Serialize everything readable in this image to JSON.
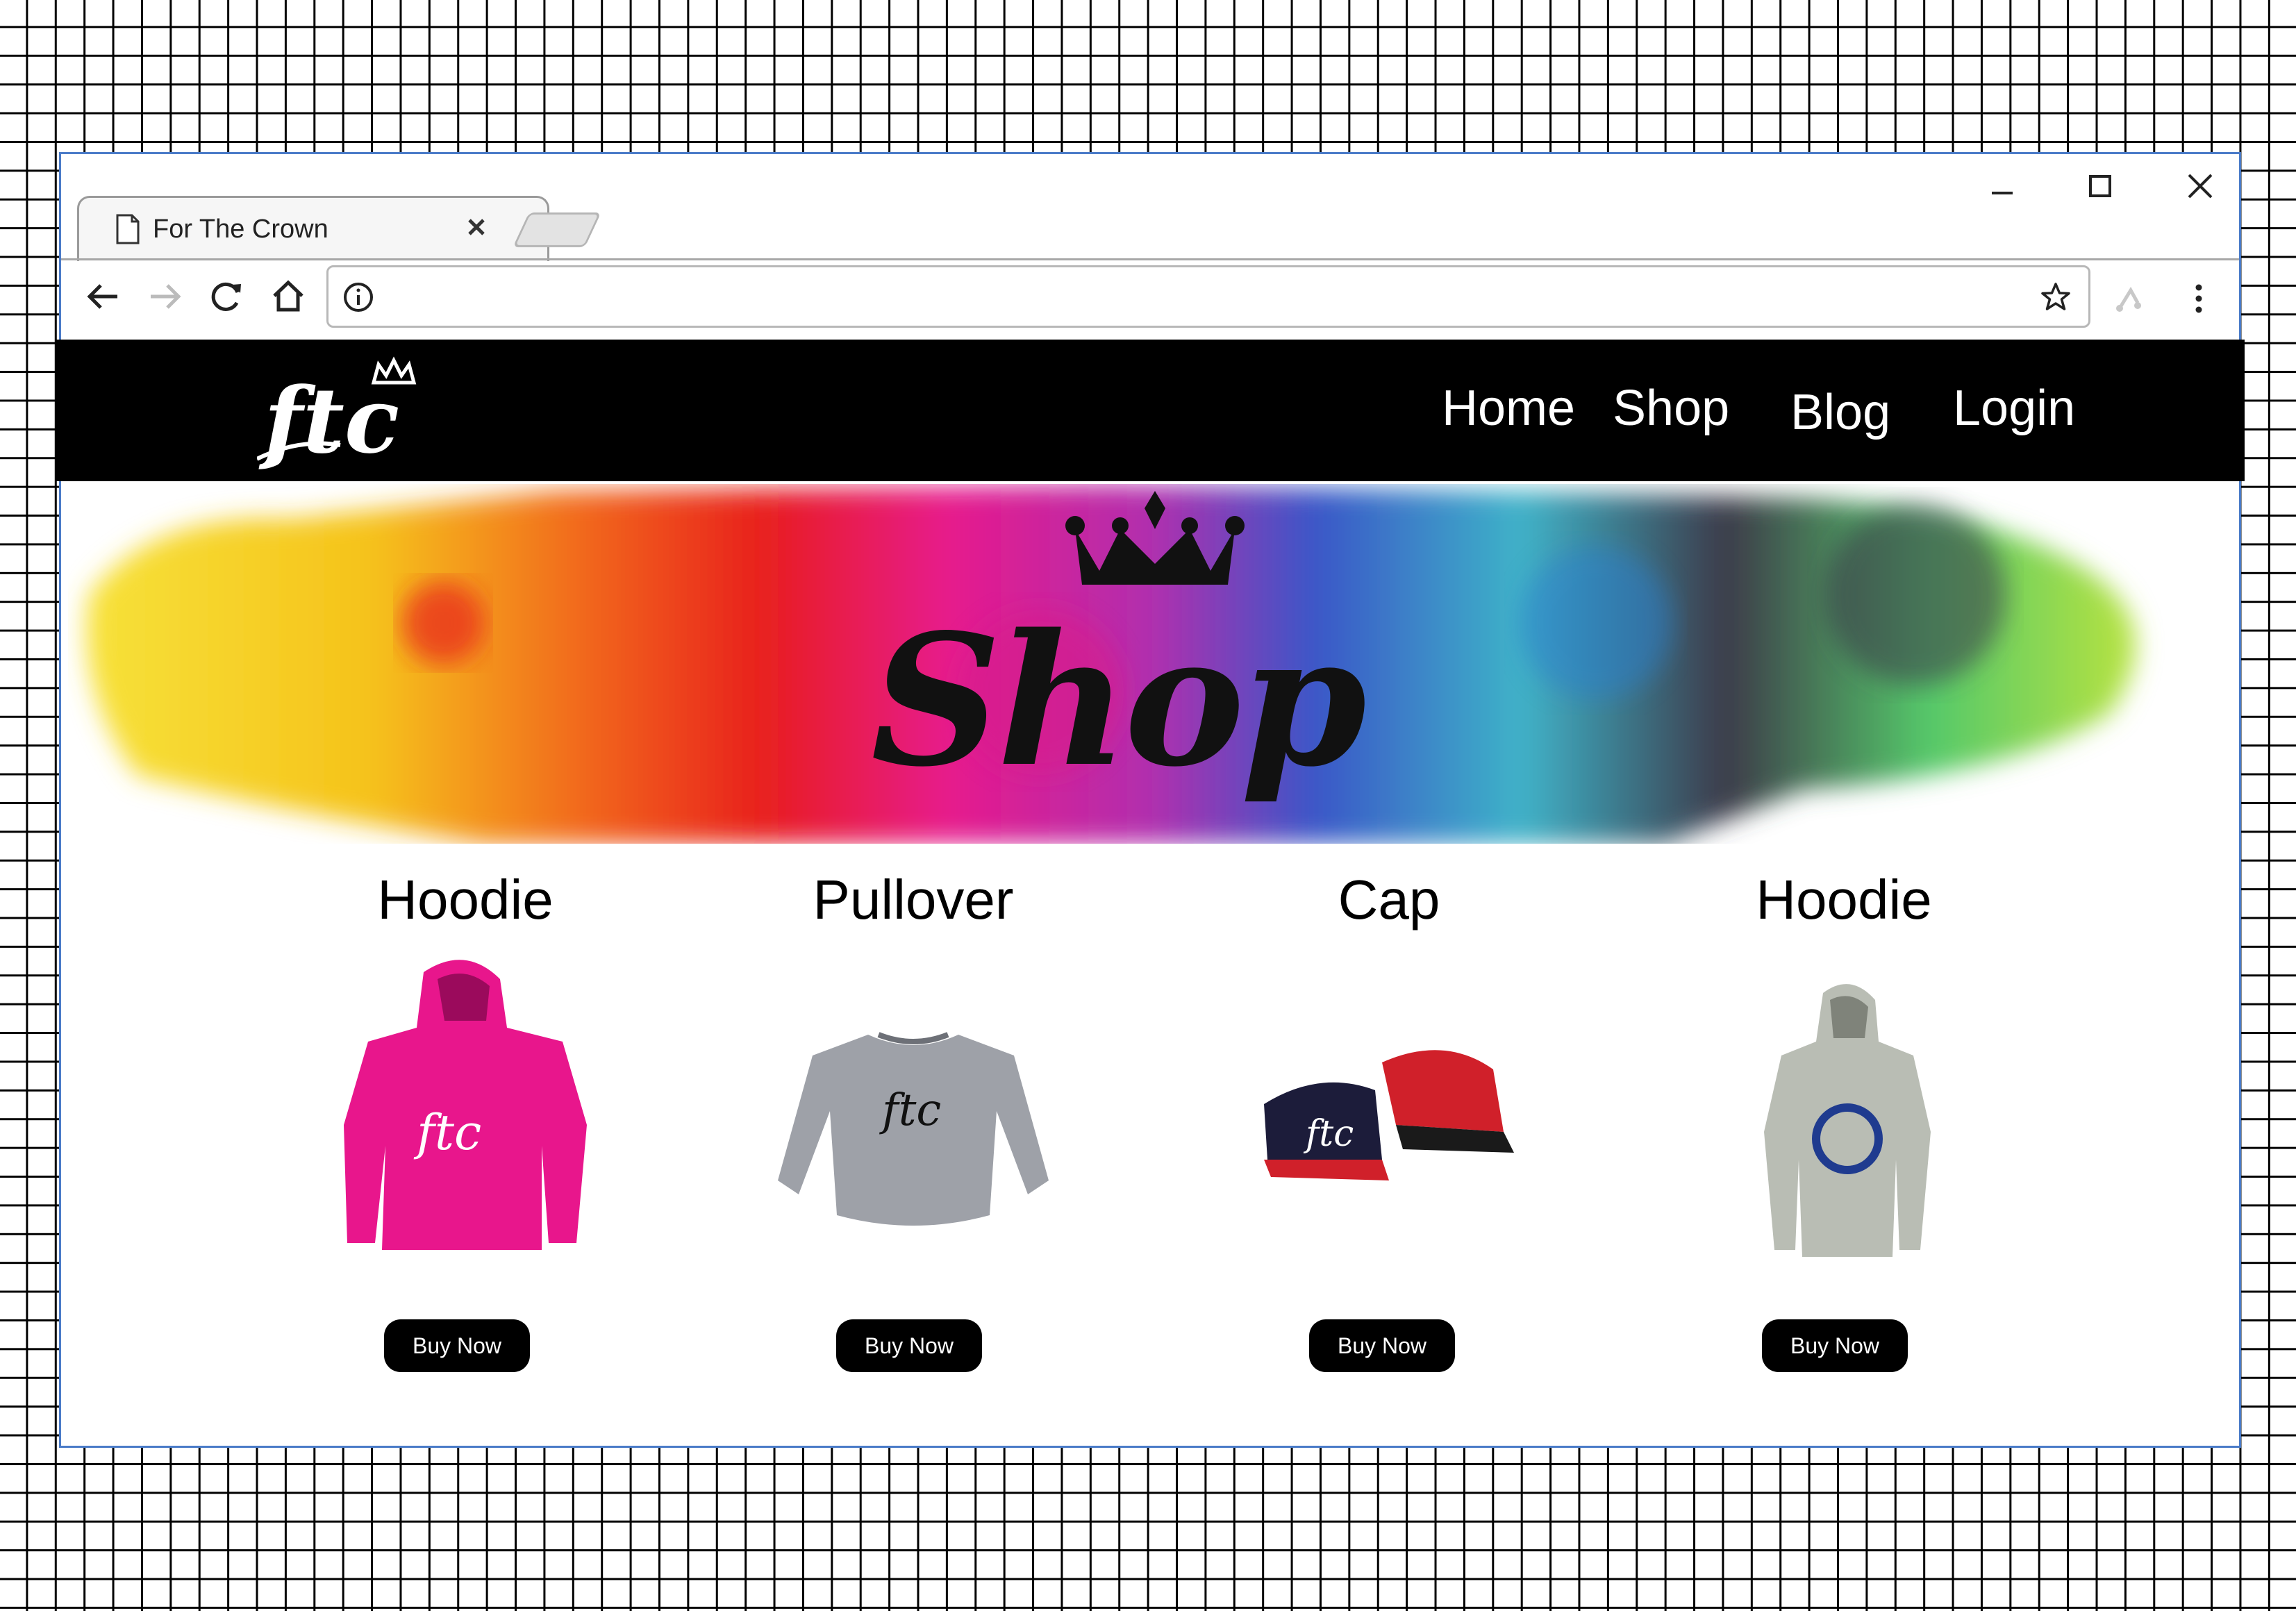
{
  "browser": {
    "tab_title": "For The Crown",
    "url": "",
    "icons": [
      "page-icon",
      "tab-close-icon",
      "back-arrow-icon",
      "forward-arrow-icon",
      "reload-icon",
      "home-icon",
      "info-icon",
      "star-icon",
      "extension-icon",
      "kebab-menu-icon",
      "minimize-icon",
      "maximize-icon",
      "close-icon"
    ]
  },
  "site": {
    "logo_text": "ftc",
    "nav": {
      "home": "Home",
      "shop": "Shop",
      "blog": "Blog",
      "login": "Login"
    },
    "hero_title": "Shop",
    "colors": {
      "nav_bg": "#000000",
      "nav_text": "#ffffff",
      "button_bg": "#000000",
      "button_text": "#ffffff"
    }
  },
  "products": [
    {
      "name": "Hoodie",
      "button": "Buy Now",
      "image": "pink-hoodie",
      "color": "#e8168c"
    },
    {
      "name": "Pullover",
      "button": "Buy Now",
      "image": "gray-pullover",
      "color": "#9ea1a8"
    },
    {
      "name": "Cap",
      "button": "Buy Now",
      "image": "caps",
      "color": "#1c1c3a"
    },
    {
      "name": "Hoodie",
      "button": "Buy Now",
      "image": "gray-hoodie",
      "color": "#b9bdb4"
    }
  ]
}
